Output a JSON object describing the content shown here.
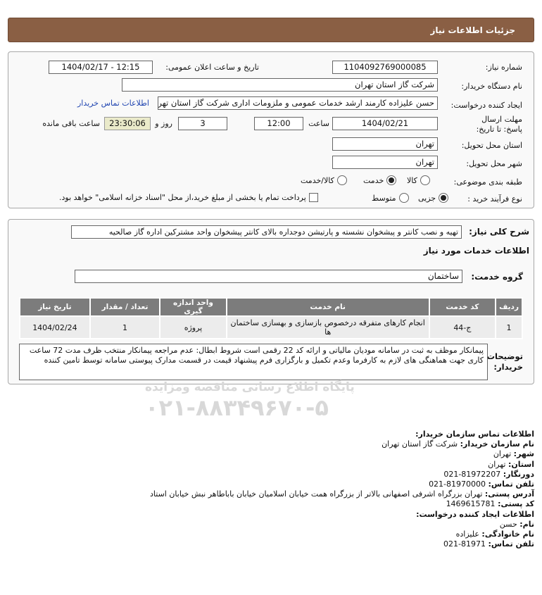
{
  "header": {
    "title": "جزئیات اطلاعات نیاز"
  },
  "form": {
    "need_number_label": "شماره نیاز:",
    "need_number": "1104092769000085",
    "announce_label": "تاریخ و ساعت اعلان عمومی:",
    "announce_value": "1404/02/17 - 12:15",
    "buyer_org_label": "نام دستگاه خریدار:",
    "buyer_org": "شرکت گاز استان تهران",
    "creator_label": "ایجاد کننده درخواست:",
    "creator": "حسن علیزاده کارمند ارشد خدمات عمومی و ملزومات اداری شرکت گاز استان تهران",
    "contact_link": "اطلاعات تماس خریدار",
    "deadline_label": "مهلت ارسال پاسخ: تا تاریخ:",
    "deadline_date": "1404/02/21",
    "time_label": "ساعت",
    "deadline_time": "12:00",
    "days_value": "3",
    "days_label": "روز و",
    "remaining_time": "23:30:06",
    "remaining_label": "ساعت باقی مانده",
    "province_label": "استان محل تحویل:",
    "province": "تهران",
    "city_label": "شهر محل تحویل:",
    "city": "تهران",
    "category_label": "طبقه بندی موضوعی:",
    "category_options": [
      "کالا",
      "خدمت",
      "کالا/خدمت"
    ],
    "category_selected": "خدمت",
    "process_label": "نوع فرآیند خرید :",
    "process_options": [
      "جزیی",
      "متوسط"
    ],
    "process_selected": "جزیی",
    "payment_note": "پرداخت تمام یا بخشی از مبلغ خرید،از محل \"اسناد خزانه اسلامی\" خواهد بود."
  },
  "description": {
    "label": "شرح کلی نیاز:",
    "text": "تهیه و نصب کانتر و پیشخوان نشسته و پارتیشن دوجداره بالای کانتر پیشخوان واحد مشترکین اداره گاز صالحیه"
  },
  "services": {
    "section_title": "اطلاعات خدمات مورد نیاز",
    "group_label": "گروه خدمت:",
    "group_value": "ساختمان",
    "columns": [
      "ردیف",
      "کد خدمت",
      "نام خدمت",
      "واحد اندازه گیری",
      "تعداد / مقدار",
      "تاریخ نیاز"
    ],
    "rows": [
      {
        "row": "1",
        "code": "ج-44",
        "name": "انجام کارهای متفرقه درخصوص بازسازی و بهسازی ساختمان ها",
        "unit": "پروژه",
        "qty": "1",
        "date": "1404/02/24"
      }
    ]
  },
  "buyer_notes": {
    "label": "توضیحات خریدار:",
    "text": "پیمانکار موظف به ثبت در سامانه مودیان مالیاتی و ارائه کد 22 رقمی است شروط ابطال: عدم مراجعه پیمانکار منتخب ظرف مدت 72 ساعت کاری جهت هماهنگی های لازم به کارفرما وعدم تکمیل و بارگزاری فرم پیشنهاد قیمت در قسمت مدارک پیوستی سامانه توسط تامین کننده"
  },
  "buyer_contact": {
    "title": "اطلاعات تماس سازمان خریدار:",
    "org_label": "نام سازمان خریدار:",
    "org": "شرکت گاز استان تهران",
    "city_label": "شهر:",
    "city": "تهران",
    "province_label": "استان:",
    "province": "تهران",
    "fax_label": "دورنگار:",
    "fax": "021-81972207",
    "phone_label": "تلفن تماس:",
    "phone": "021-81970000",
    "address_label": "آدرس پستی:",
    "address": "تهران بزرگراه اشرفی اصفهانی بالاتر از بزرگراه همت خیابان اسلامیان خیابان باباطاهر نبش خیابان استاد",
    "postal_label": "کد پستی:",
    "postal": "1469615781"
  },
  "creator_contact": {
    "title": "اطلاعات ایجاد کننده درخواست:",
    "name_label": "نام:",
    "name": "حسن",
    "family_label": "نام خانوادگی:",
    "family": "علیزاده",
    "phone_label": "تلفن تماس:",
    "phone": "021-81971"
  },
  "watermark": {
    "line1": "پایگاه اطلاع رسانی مناقصه ومزایده",
    "line2": "۰۲۱-۸۸۳۴۹۶۷۰-۵"
  },
  "colors": {
    "header_bg": "#8a5f44",
    "table_header": "#7c7c7c",
    "link": "#1f44b0"
  }
}
